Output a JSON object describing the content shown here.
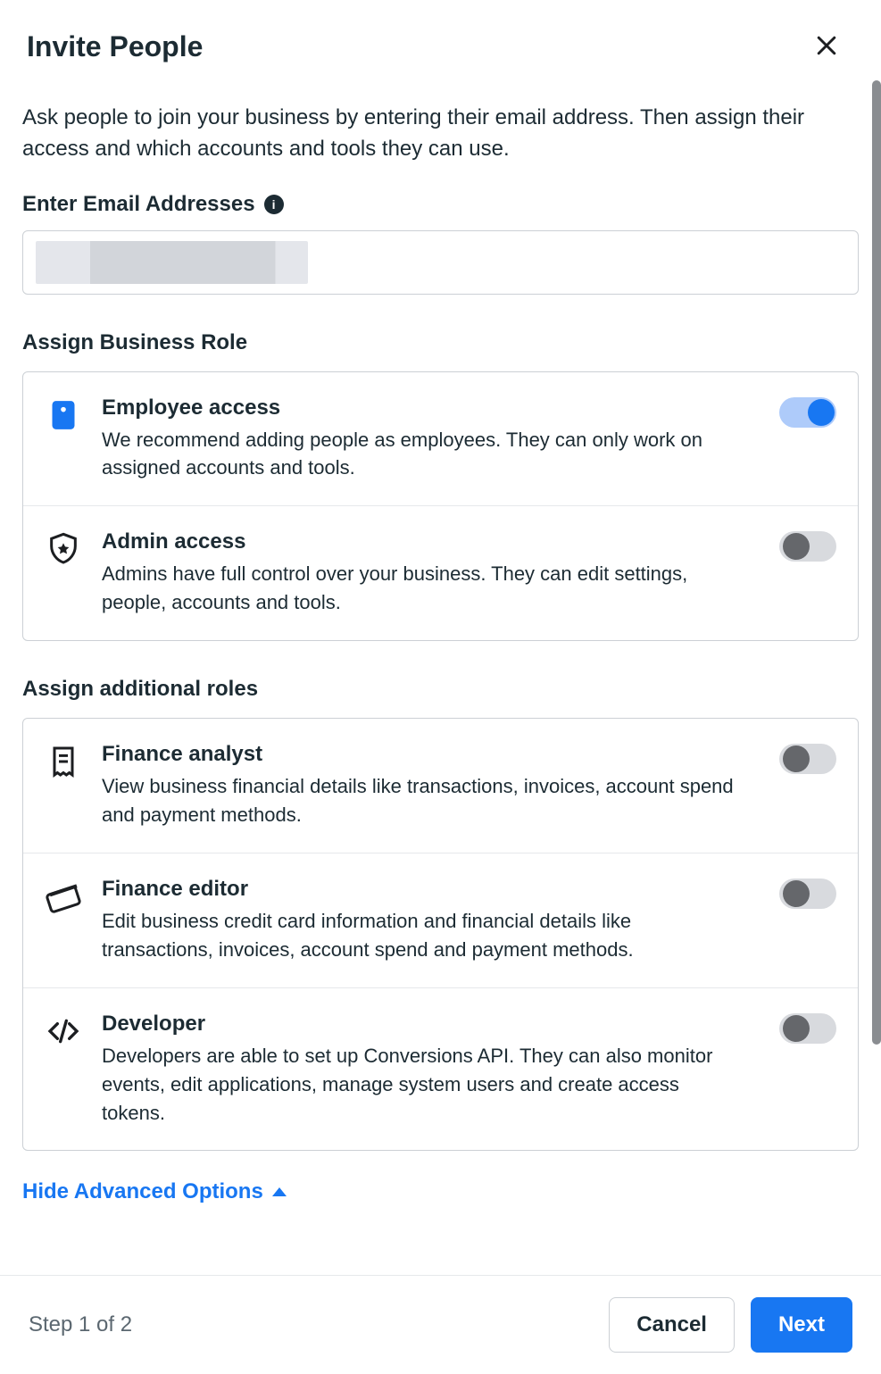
{
  "header": {
    "title": "Invite People"
  },
  "intro": "Ask people to join your business by entering their email address. Then assign their access and which accounts and tools they can use.",
  "email_section": {
    "label": "Enter Email Addresses",
    "value": ""
  },
  "business_role_section": {
    "title": "Assign Business Role",
    "roles": [
      {
        "key": "employee",
        "icon": "id-badge-icon",
        "title": "Employee access",
        "description": "We recommend adding people as employees. They can only work on assigned accounts and tools.",
        "enabled": true
      },
      {
        "key": "admin",
        "icon": "shield-star-icon",
        "title": "Admin access",
        "description": "Admins have full control over your business. They can edit settings, people, accounts and tools.",
        "enabled": false
      }
    ]
  },
  "additional_roles_section": {
    "title": "Assign additional roles",
    "roles": [
      {
        "key": "finance_analyst",
        "icon": "receipt-icon",
        "title": "Finance analyst",
        "description": "View business financial details like transactions, invoices, account spend and payment methods.",
        "enabled": false
      },
      {
        "key": "finance_editor",
        "icon": "credit-card-icon",
        "title": "Finance editor",
        "description": "Edit business credit card information and financial details like transactions, invoices, account spend and payment methods.",
        "enabled": false
      },
      {
        "key": "developer",
        "icon": "code-icon",
        "title": "Developer",
        "description": "Developers are able to set up Conversions API. They can also monitor events, edit applications, manage system users and create access tokens.",
        "enabled": false
      }
    ]
  },
  "advanced_link": "Hide Advanced Options",
  "footer": {
    "step": "Step 1 of 2",
    "cancel": "Cancel",
    "next": "Next"
  }
}
